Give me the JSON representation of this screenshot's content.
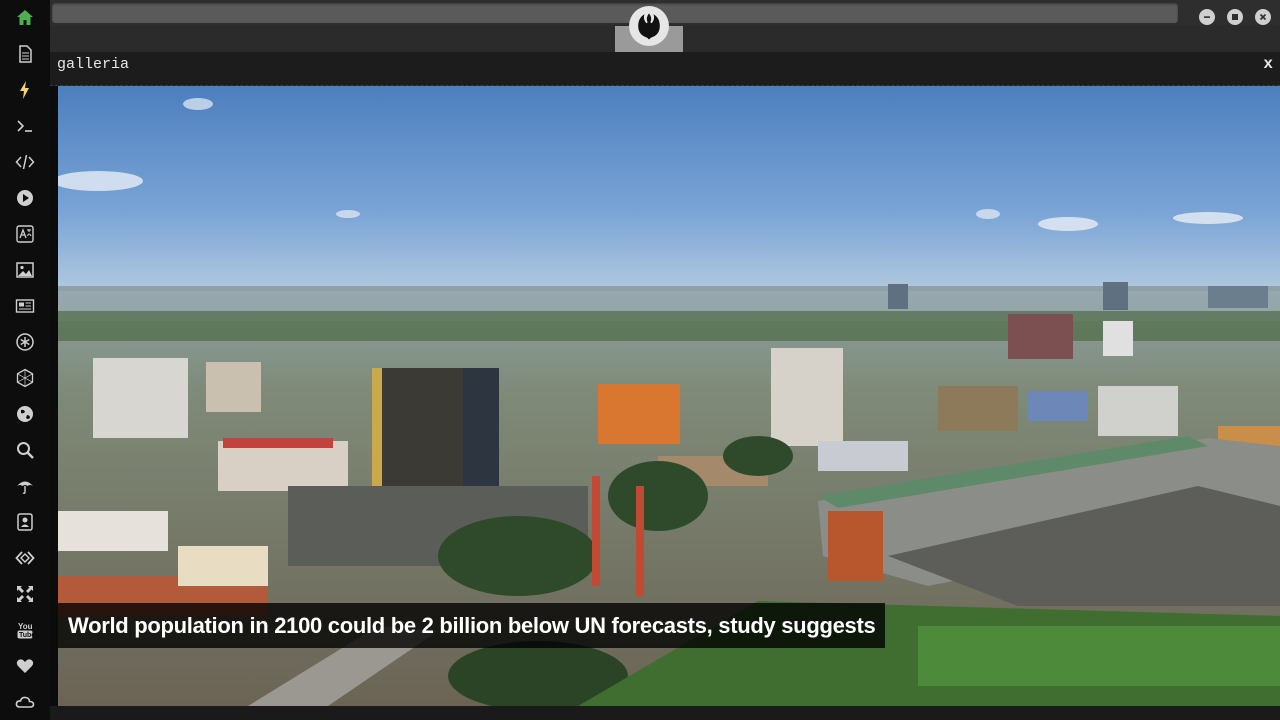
{
  "window": {
    "logo_icon": "rebel-alliance-emblem-icon",
    "controls": [
      "minimize-icon",
      "maximize-icon",
      "close-icon"
    ]
  },
  "sidebar": {
    "items": [
      {
        "icon": "home-icon",
        "color": "#4caf50"
      },
      {
        "icon": "document-icon",
        "color": "#cfcfcf"
      },
      {
        "icon": "lightning-icon",
        "color": "#f5d76e"
      },
      {
        "icon": "terminal-icon",
        "color": "#cfcfcf"
      },
      {
        "icon": "code-icon",
        "color": "#cfcfcf"
      },
      {
        "icon": "play-icon",
        "color": "#cfcfcf"
      },
      {
        "icon": "translate-icon",
        "color": "#cfcfcf"
      },
      {
        "icon": "image-icon",
        "color": "#cfcfcf"
      },
      {
        "icon": "newspaper-icon",
        "color": "#cfcfcf"
      },
      {
        "icon": "asterisk-icon",
        "color": "#cfcfcf"
      },
      {
        "icon": "hexagon-icon",
        "color": "#cfcfcf"
      },
      {
        "icon": "globe-icon",
        "color": "#cfcfcf"
      },
      {
        "icon": "search-icon",
        "color": "#cfcfcf"
      },
      {
        "icon": "umbrella-icon",
        "color": "#cfcfcf"
      },
      {
        "icon": "contact-card-icon",
        "color": "#cfcfcf"
      },
      {
        "icon": "diamond-code-icon",
        "color": "#cfcfcf"
      },
      {
        "icon": "expand-arrows-icon",
        "color": "#cfcfcf"
      },
      {
        "icon": "youtube-icon",
        "color": "#cfcfcf"
      },
      {
        "icon": "heart-icon",
        "color": "#cfcfcf"
      },
      {
        "icon": "cloud-icon",
        "color": "#cfcfcf"
      }
    ]
  },
  "panel": {
    "title": "galleria",
    "close_label": "x"
  },
  "gallery": {
    "caption": "World population in 2100 could be 2 billion below UN forecasts, study suggests",
    "image_subject": "aerial-city-skyline-with-stadium"
  },
  "colors": {
    "accent_home": "#4caf50",
    "accent_lightning": "#f5d76e",
    "sidebar_bg": "#0d0d0d",
    "panel_bg": "#1c1c1c"
  }
}
